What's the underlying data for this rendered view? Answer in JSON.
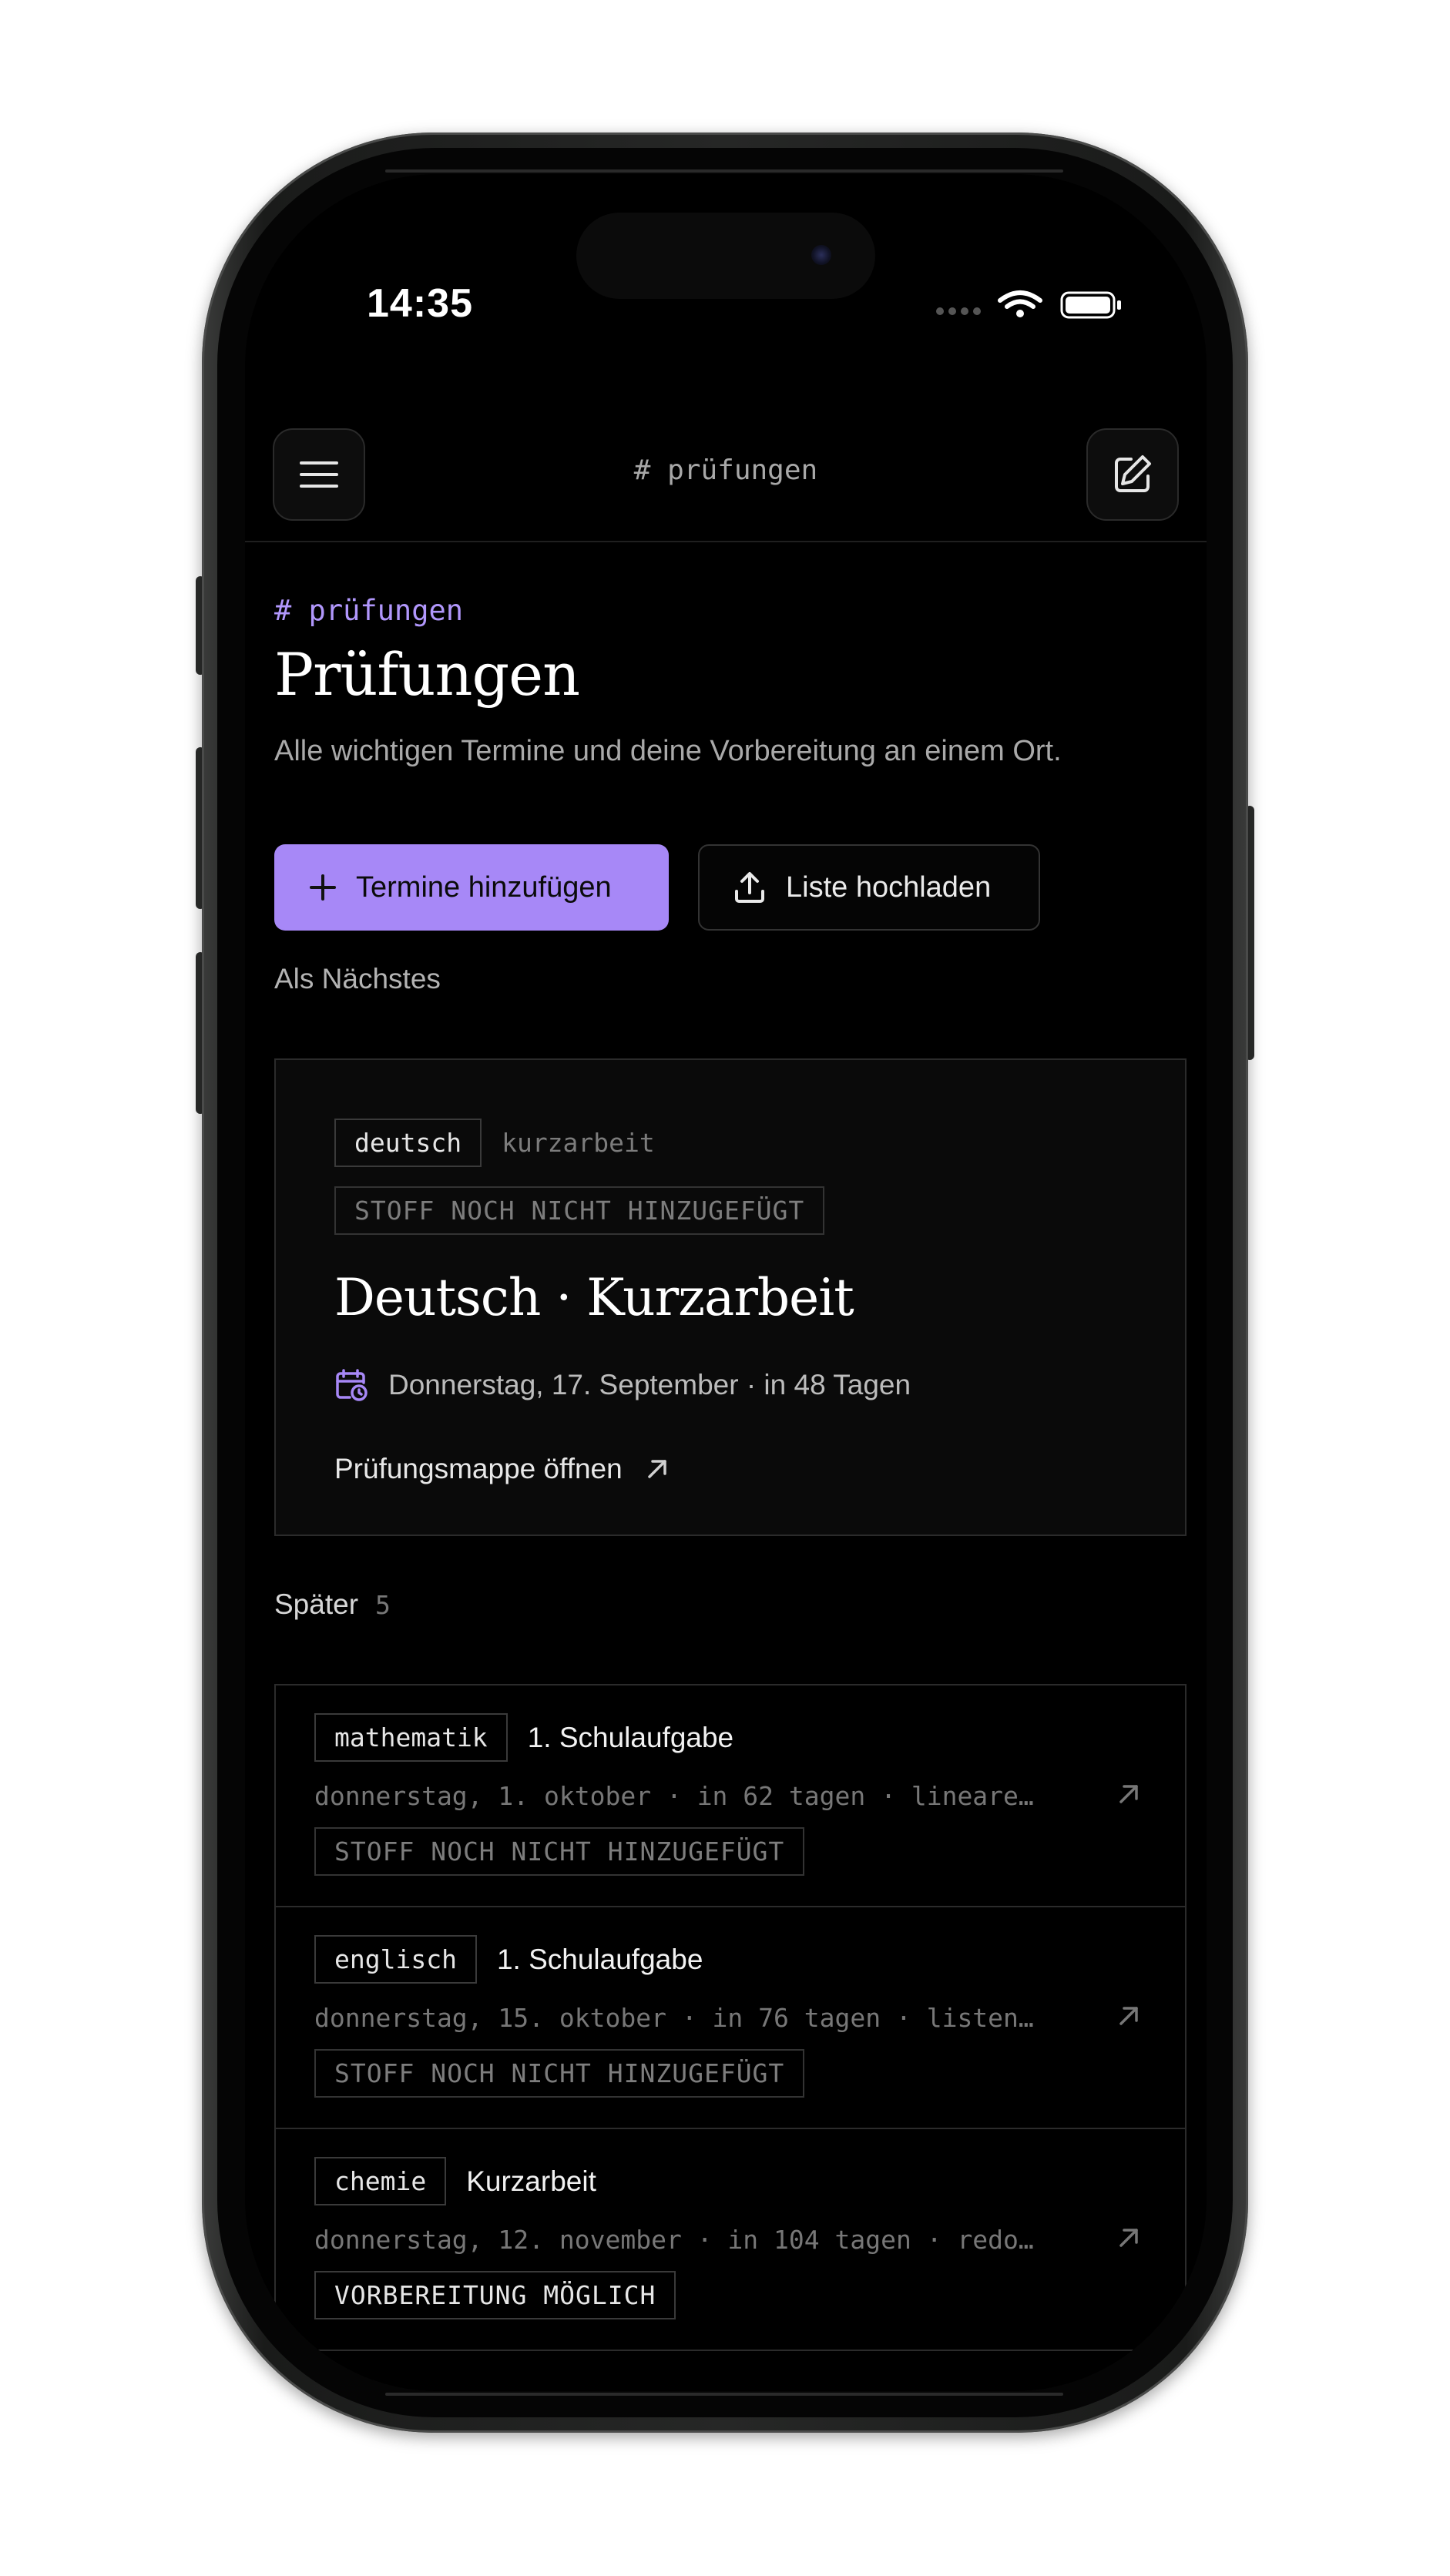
{
  "status_bar": {
    "time": "14:35"
  },
  "nav": {
    "title": "# prüfungen"
  },
  "header": {
    "section_tag": "# prüfungen",
    "title": "Prüfungen",
    "description": "Alle wichtigen Termine und deine Vorbereitung an einem Ort."
  },
  "actions": {
    "add_label": "Termine hinzufügen",
    "upload_label": "Liste hochladen"
  },
  "next": {
    "section_label": "Als Nächstes",
    "subject": "deutsch",
    "type": "kurzarbeit",
    "status": "STOFF NOCH NICHT HINZUGEFÜGT",
    "title": "Deutsch · Kurzarbeit",
    "date": "Donnerstag, 17. September · in 48 Tagen",
    "link_label": "Prüfungsmappe öffnen"
  },
  "later": {
    "label": "Später",
    "count": "5",
    "items": [
      {
        "subject": "mathematik",
        "title": "1. Schulaufgabe",
        "meta": "donnerstag, 1. oktober · in 62 tagen · lineare…",
        "status": "STOFF NOCH NICHT HINZUGEFÜGT"
      },
      {
        "subject": "englisch",
        "title": "1. Schulaufgabe",
        "meta": "donnerstag, 15. oktober · in 76 tagen · listen…",
        "status": "STOFF NOCH NICHT HINZUGEFÜGT"
      },
      {
        "subject": "chemie",
        "title": "Kurzarbeit",
        "meta": "donnerstag, 12. november · in 104 tagen · redo…",
        "status": "VORBEREITUNG MÖGLICH"
      }
    ]
  },
  "colors": {
    "accent": "#a788f7",
    "accent_text": "#b197fc",
    "background": "#000000"
  },
  "icons": {
    "menu": "menu-icon",
    "edit": "compose-icon",
    "add": "plus-icon",
    "upload": "upload-icon",
    "calendar": "calendar-clock-icon",
    "open": "arrow-up-right-icon"
  }
}
